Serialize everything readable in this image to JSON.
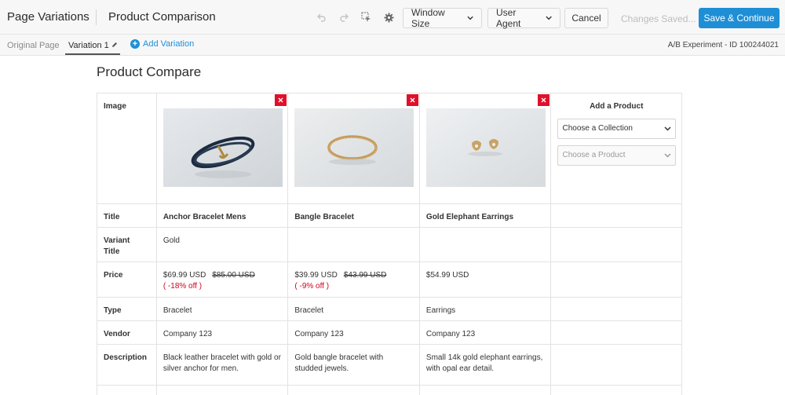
{
  "topbar": {
    "app_title": "Page Variations",
    "page_name": "Product Comparison",
    "window_size_label": "Window Size",
    "user_agent_label": "User Agent",
    "cancel_label": "Cancel",
    "saved_status": "Changes Saved...",
    "save_label": "Save & Continue"
  },
  "subbar": {
    "tab_original": "Original Page",
    "tab_variation": "Variation 1",
    "add_variation": "Add Variation",
    "experiment_id": "A/B Experiment - ID 100244021"
  },
  "main": {
    "heading": "Product Compare",
    "row_labels": {
      "image": "Image",
      "title": "Title",
      "variant_title_1": "Variant",
      "variant_title_2": "Title",
      "price": "Price",
      "type": "Type",
      "vendor": "Vendor",
      "description": "Description"
    },
    "products": [
      {
        "title": "Anchor Bracelet Mens",
        "variant": "Gold",
        "price": "$69.99 USD",
        "compare_price": "$85.00 USD",
        "discount": "( -18% off )",
        "type": "Bracelet",
        "vendor": "Company 123",
        "description": "Black leather bracelet with gold or silver anchor for men."
      },
      {
        "title": "Bangle Bracelet",
        "variant": "",
        "price": "$39.99 USD",
        "compare_price": "$43.99 USD",
        "discount": "( -9% off )",
        "type": "Bracelet",
        "vendor": "Company 123",
        "description": "Gold bangle bracelet with studded jewels."
      },
      {
        "title": "Gold Elephant Earrings",
        "variant": "",
        "price": "$54.99 USD",
        "compare_price": "",
        "discount": "",
        "type": "Earrings",
        "vendor": "Company 123",
        "description": "Small 14k gold elephant earrings, with opal ear detail."
      }
    ],
    "add_product": {
      "title": "Add a Product",
      "collection_placeholder": "Choose a Collection",
      "product_placeholder": "Choose a Product"
    }
  },
  "colors": {
    "accent": "#1e8fd6",
    "remove": "#e0102a",
    "discount": "#d0021b"
  },
  "icons": [
    "undo-icon",
    "redo-icon",
    "select-element-icon",
    "gear-icon",
    "chevron-down-icon",
    "pencil-icon",
    "plus-icon",
    "close-icon"
  ]
}
